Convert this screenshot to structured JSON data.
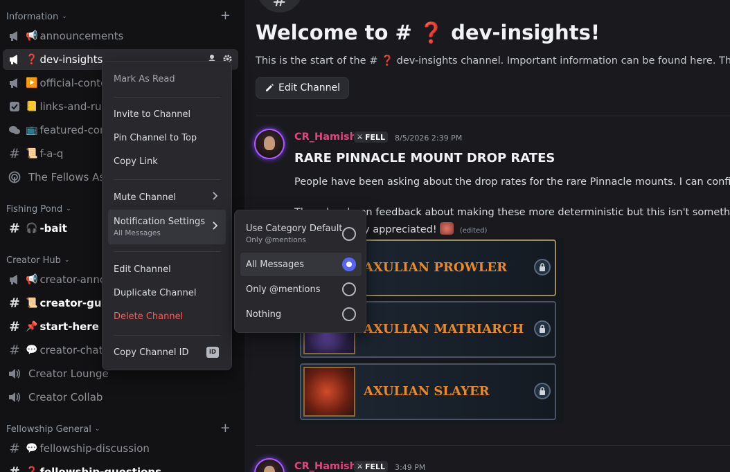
{
  "sidebar": {
    "categories": {
      "information": "Information",
      "fishing": "Fishing Pond",
      "creator": "Creator Hub",
      "fellowship": "Fellowship General"
    },
    "channels": {
      "announcements": {
        "emoji": "📢",
        "label": "announcements"
      },
      "dev_insights": {
        "emoji": "❓",
        "label": "dev-insights"
      },
      "official_content": {
        "emoji": "▶️",
        "label": "official-conte"
      },
      "links_and_rules": {
        "emoji": "📒",
        "label": "links-and-rul"
      },
      "featured_content": {
        "emoji": "📺",
        "label": "featured-con"
      },
      "faq": {
        "emoji": "📜",
        "label": "f-a-q"
      },
      "fellows_assembly": {
        "label": "The Fellows Ass"
      },
      "bait": {
        "emoji": "🎧",
        "label": "-bait"
      },
      "creator_announcements": {
        "emoji": "📢",
        "label": "creator-anno"
      },
      "creator_guide": {
        "emoji": "📜",
        "label": "creator-guide"
      },
      "start_here": {
        "emoji": "📌",
        "label": "start-here"
      },
      "creator_chat": {
        "emoji": "💬",
        "label": "creator-chat"
      },
      "creator_lounge": {
        "label": "Creator Lounge"
      },
      "creator_collab": {
        "label": "Creator Collab"
      },
      "fellowship_discussion": {
        "emoji": "💬",
        "label": "fellowship-discussion"
      },
      "fellowship_questions": {
        "emoji": "❓",
        "label": "fellowship-questions"
      }
    }
  },
  "main": {
    "hash_symbol": "#",
    "welcome": "Welcome to # ❓ dev-insights!",
    "intro": "This is the start of the # ❓ dev-insights channel. Important information can be found here. Think of it",
    "edit_channel": "Edit Channel",
    "message1": {
      "author": "CR_Hamish",
      "tag": "FELL",
      "timestamp": "8/5/2026 2:39 PM",
      "title": "RARE PINNACLE MOUNT DROP RATES",
      "line1": "People have been asking about the drop rates for the rare Pinnacle mounts. I can confirm the",
      "line2_start": "There has been feedback about making these more deterministic but this isn't something",
      "line3": "always, is truly appreciated!",
      "edited": "(edited)"
    },
    "mounts": [
      {
        "name": "AXULIAN PROWLER"
      },
      {
        "name": "AXULIAN MATRIARCH"
      },
      {
        "name": "AXULIAN SLAYER"
      }
    ],
    "message2": {
      "author": "CR_Hamish",
      "tag": "FELL",
      "timestamp": "3:49 PM"
    }
  },
  "context_menu": {
    "mark_as_read": "Mark As Read",
    "invite": "Invite to Channel",
    "pin": "Pin Channel to Top",
    "copy_link": "Copy Link",
    "mute": "Mute Channel",
    "notification_settings": "Notification Settings",
    "notification_current": "All Messages",
    "edit": "Edit Channel",
    "duplicate": "Duplicate Channel",
    "delete": "Delete Channel",
    "copy_id": "Copy Channel ID",
    "id_badge": "ID"
  },
  "notification_submenu": {
    "options": [
      {
        "label": "Use Category Default",
        "sub": "Only @mentions",
        "selected": false
      },
      {
        "label": "All Messages",
        "selected": true
      },
      {
        "label": "Only @mentions",
        "selected": false
      },
      {
        "label": "Nothing",
        "selected": false
      }
    ]
  },
  "colors": {
    "accent": "#5865f2",
    "danger": "#f0605e",
    "author": "#e0457b",
    "mount_name": "#e88a2a"
  }
}
